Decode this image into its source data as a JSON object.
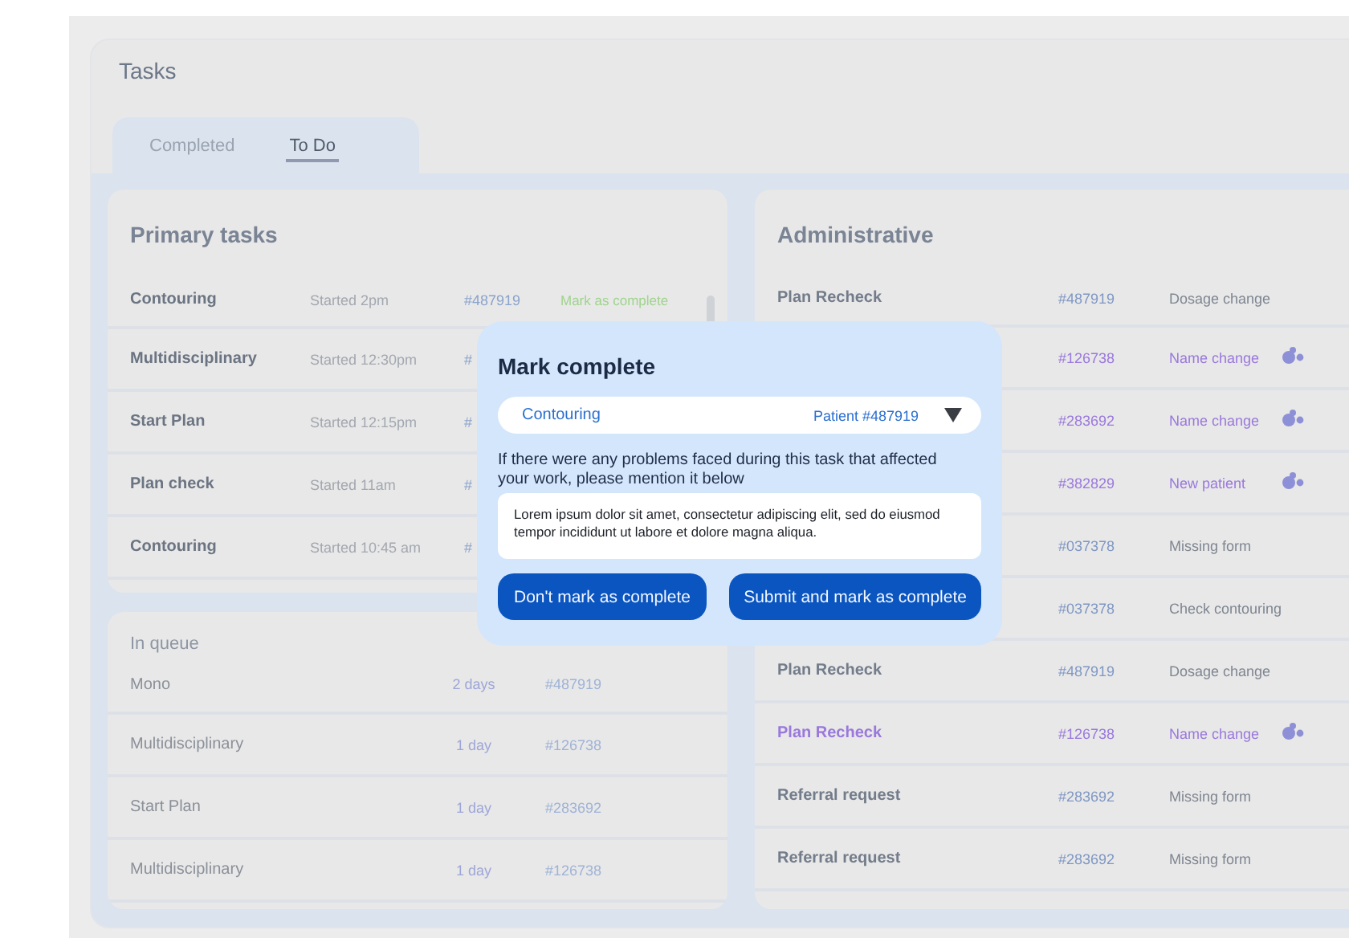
{
  "title": "Tasks",
  "tabs": [
    {
      "label": "Completed",
      "selected": false
    },
    {
      "label": "To Do",
      "selected": true
    }
  ],
  "primary_tasks": {
    "heading": "Primary tasks",
    "rows": [
      {
        "name": "Contouring",
        "started": "Started 2pm",
        "id": "#487919",
        "action": "Mark as complete"
      },
      {
        "name": "Multidisciplinary",
        "started": "Started 12:30pm",
        "id": "#"
      },
      {
        "name": "Start Plan",
        "started": "Started 12:15pm",
        "id": "#"
      },
      {
        "name": "Plan check",
        "started": "Started 11am",
        "id": "#"
      },
      {
        "name": "Contouring",
        "started": "Started 10:45 am",
        "id": "#"
      }
    ]
  },
  "in_queue": {
    "heading": "In queue",
    "rows": [
      {
        "name": "Mono",
        "wait": "2 days",
        "id": "#487919"
      },
      {
        "name": "Multidisciplinary",
        "wait": "1 day",
        "id": "#126738"
      },
      {
        "name": "Start Plan",
        "wait": "1 day",
        "id": "#283692"
      },
      {
        "name": "Multidisciplinary",
        "wait": "1 day",
        "id": "#126738"
      }
    ]
  },
  "administrative": {
    "heading": "Administrative",
    "rows": [
      {
        "name": "Plan Recheck",
        "id": "#487919",
        "tag": "Dosage change",
        "flagged": false
      },
      {
        "id": "#126738",
        "tag": "Name change",
        "flagged": true
      },
      {
        "id": "#283692",
        "tag": "Name change",
        "flagged": true
      },
      {
        "id": "#382829",
        "tag": "New patient",
        "flagged": true
      },
      {
        "id": "#037378",
        "tag": "Missing form",
        "flagged": false
      },
      {
        "id": "#037378",
        "tag": "Check contouring",
        "flagged": false
      },
      {
        "name": "Plan Recheck",
        "id": "#487919",
        "tag": "Dosage change",
        "flagged": false
      },
      {
        "name": "Plan Recheck",
        "id": "#126738",
        "tag": "Name change",
        "flagged": true
      },
      {
        "name": "Referral request",
        "id": "#283692",
        "tag": "Missing form",
        "flagged": false
      },
      {
        "name": "Referral request",
        "id": "#283692",
        "tag": "Missing form",
        "flagged": false
      }
    ]
  },
  "dialog": {
    "title": "Mark complete",
    "select": {
      "task": "Contouring",
      "patient": "Patient #487919"
    },
    "prompt": "If there were any problems faced during this task that affected your work, please mention it below",
    "comment": "Lorem ipsum dolor sit amet, consectetur adipiscing elit, sed do eiusmod tempor incididunt ut labore et dolore magna aliqua.",
    "buttons": [
      {
        "label": "Don't mark as complete"
      },
      {
        "label": "Submit and mark as complete"
      }
    ]
  }
}
